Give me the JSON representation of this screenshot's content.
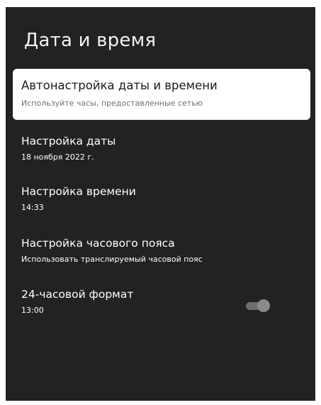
{
  "header": {
    "title": "Дата и время"
  },
  "settings": {
    "items": [
      {
        "label": "Автонастройка даты и времени",
        "value": "Используйте часы, предоставленные сетью"
      },
      {
        "label": "Настройка даты",
        "value": "18 ноября 2022 г."
      },
      {
        "label": "Настройка времени",
        "value": "14:33"
      },
      {
        "label": "Настройка часового пояса",
        "value": "Использовать транслируемый часовой пояс"
      },
      {
        "label": "24-часовой формат",
        "value": "13:00",
        "toggle_state": "off"
      }
    ]
  },
  "colors": {
    "panel_bg": "#222222",
    "selected_bg": "#ffffff",
    "text_primary": "#ffffff",
    "text_selected": "#1c1c1c",
    "text_selected_sub": "#6f6f6f",
    "toggle_track": "#6d6d6d",
    "toggle_knob": "#8a8a8a"
  }
}
